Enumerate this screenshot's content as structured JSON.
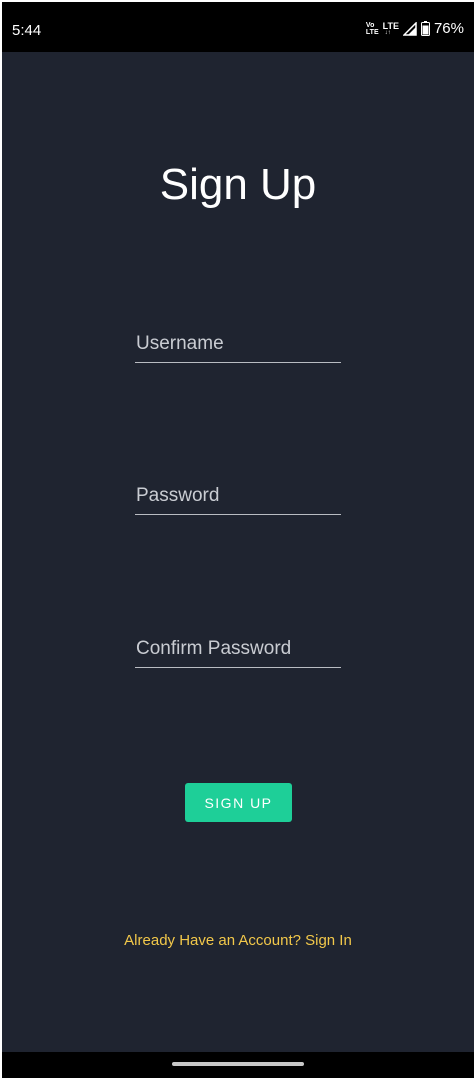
{
  "status_bar": {
    "time": "5:44",
    "volte_top": "Vo",
    "volte_bottom": "LTE",
    "network": "LTE",
    "network_arrows": "↓↑",
    "battery": "76%"
  },
  "signup": {
    "title": "Sign Up",
    "username_placeholder": "Username",
    "username_value": "",
    "password_placeholder": "Password",
    "password_value": "",
    "confirm_placeholder": "Confirm Password",
    "confirm_value": "",
    "button_label": "SIGN UP",
    "signin_link": "Already Have an Account? Sign In"
  },
  "colors": {
    "background": "#1f2430",
    "accent": "#1ecf98",
    "link": "#f2c84a"
  }
}
